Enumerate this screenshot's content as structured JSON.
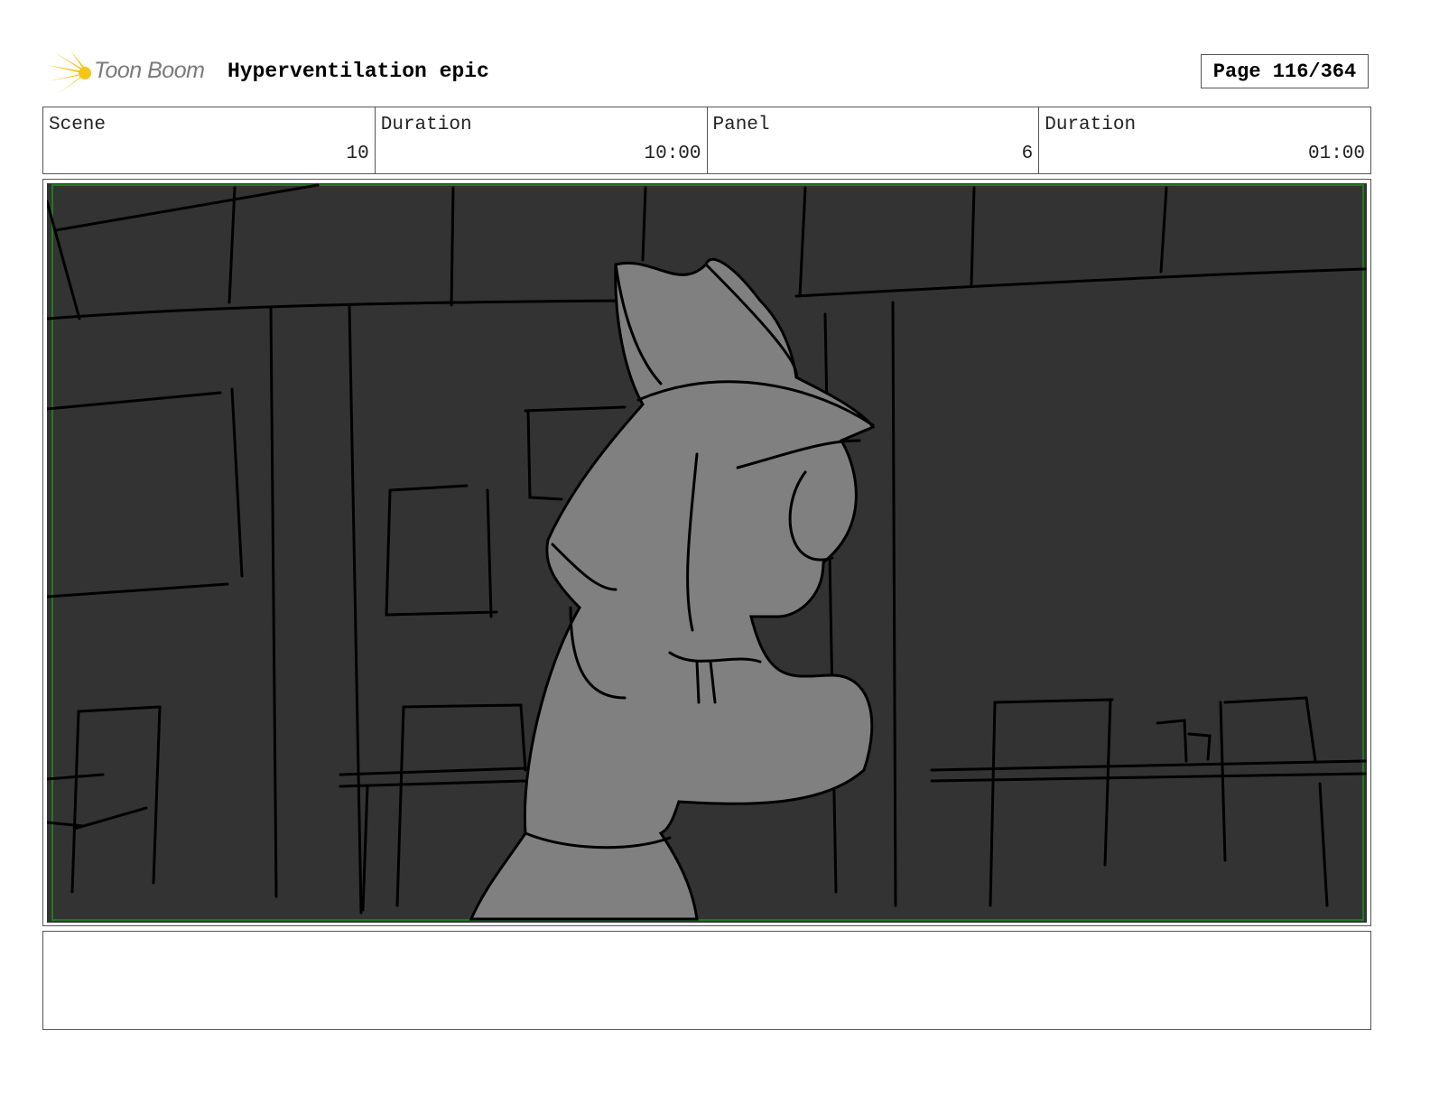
{
  "header": {
    "logo_text": "Toon Boom",
    "project_title": "Hyperventilation epic",
    "page_label": "Page 116/364"
  },
  "info": {
    "scene_label": "Scene",
    "scene_value": "10",
    "scene_duration_label": "Duration",
    "scene_duration_value": "10:00",
    "panel_label": "Panel",
    "panel_value": "6",
    "panel_duration_label": "Duration",
    "panel_duration_value": "01:00"
  },
  "panel": {
    "background_color": "#333333",
    "safe_frame_color": "#1f7a1f",
    "figure_color": "#808080"
  },
  "notes": {
    "text": ""
  }
}
